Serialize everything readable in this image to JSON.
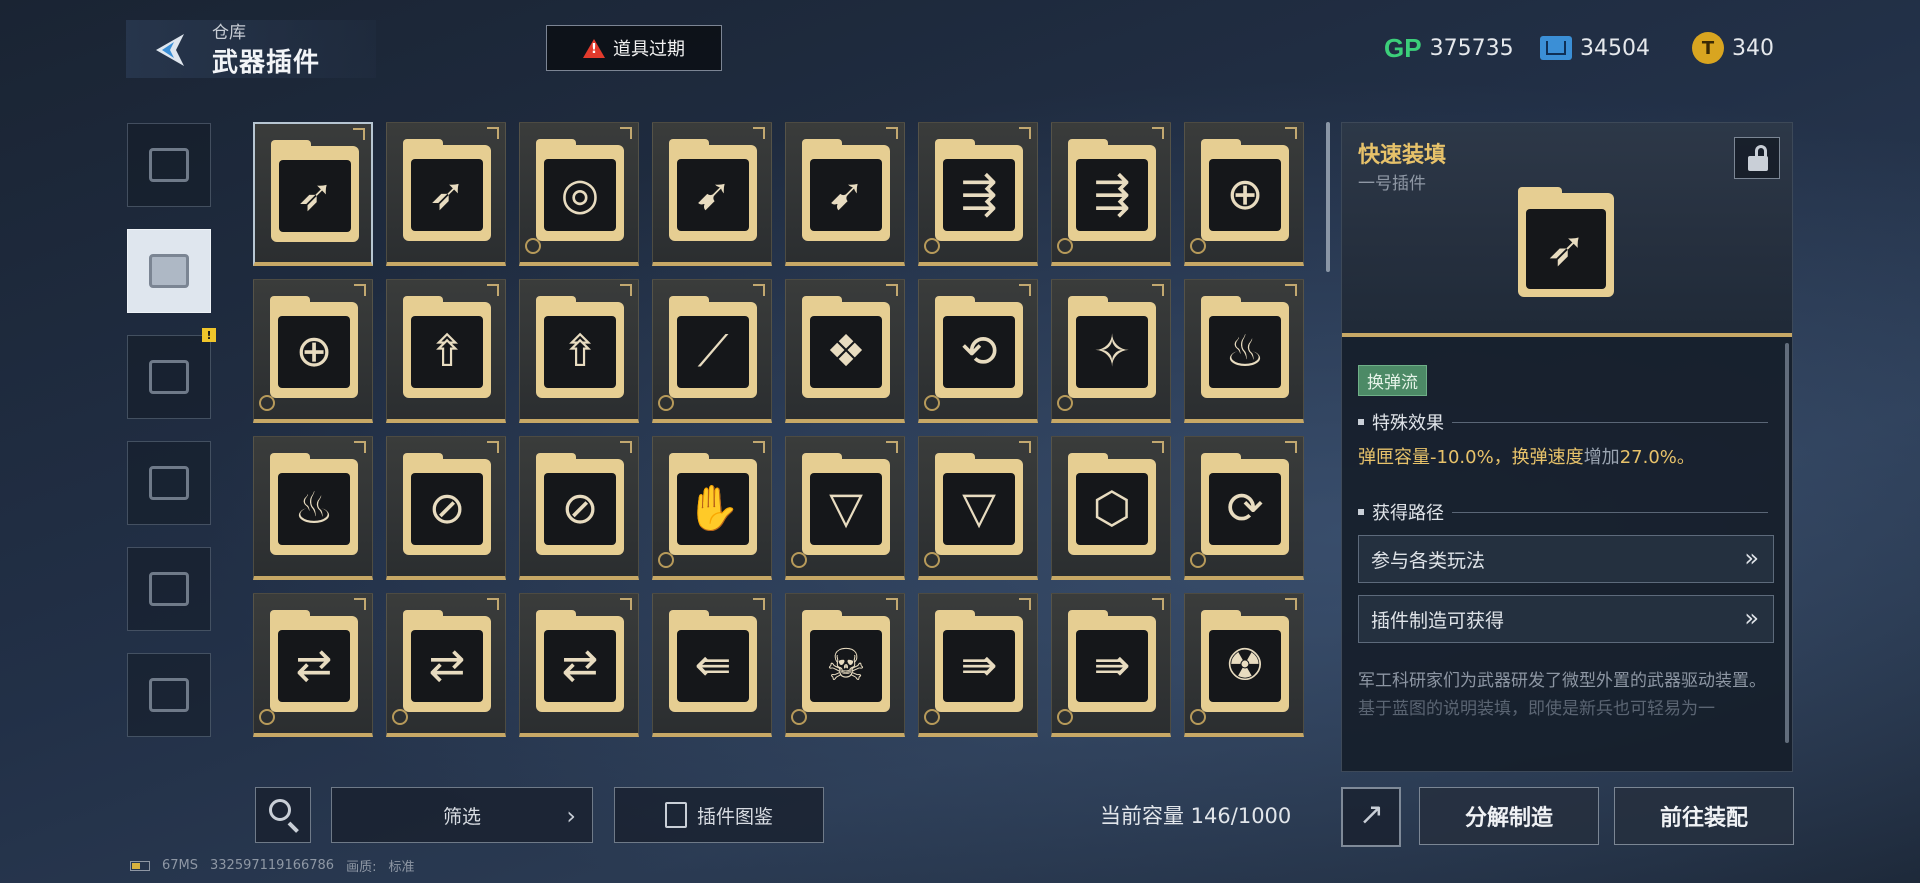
{
  "header": {
    "breadcrumb": "仓库",
    "title": "武器插件",
    "expire_button": "道具过期"
  },
  "currencies": [
    {
      "icon": "gp-icon",
      "label": "GP",
      "value": "375735"
    },
    {
      "icon": "chip-icon",
      "value": "34504"
    },
    {
      "icon": "coin-icon",
      "value": "340"
    }
  ],
  "categories": [
    {
      "name": "pistol-icon"
    },
    {
      "name": "plugin-card-icon",
      "active": true
    },
    {
      "name": "grenade-icon",
      "alert": "!"
    },
    {
      "name": "swap-icon"
    },
    {
      "name": "figure-icon"
    },
    {
      "name": "star-badge-icon"
    }
  ],
  "grid": {
    "slots": [
      {
        "glyph": "➶",
        "gear": false,
        "selected": true
      },
      {
        "glyph": "➶",
        "gear": false
      },
      {
        "glyph": "◎",
        "gear": true
      },
      {
        "glyph": "➹",
        "gear": false
      },
      {
        "glyph": "➹",
        "gear": false
      },
      {
        "glyph": "⇶",
        "gear": true
      },
      {
        "glyph": "⇶",
        "gear": true
      },
      {
        "glyph": "⊕",
        "gear": true
      },
      {
        "glyph": "⊕",
        "gear": true
      },
      {
        "glyph": "⇮",
        "gear": false
      },
      {
        "glyph": "⇮",
        "gear": false
      },
      {
        "glyph": "⟋",
        "gear": true
      },
      {
        "glyph": "❖",
        "gear": false
      },
      {
        "glyph": "⟲",
        "gear": true
      },
      {
        "glyph": "✧",
        "gear": true
      },
      {
        "glyph": "♨",
        "gear": false
      },
      {
        "glyph": "♨",
        "gear": false
      },
      {
        "glyph": "⊘",
        "gear": false
      },
      {
        "glyph": "⊘",
        "gear": false
      },
      {
        "glyph": "✋",
        "gear": true
      },
      {
        "glyph": "▽",
        "gear": true
      },
      {
        "glyph": "▽",
        "gear": true
      },
      {
        "glyph": "⬡",
        "gear": false
      },
      {
        "glyph": "⟳",
        "gear": true
      },
      {
        "glyph": "⇄",
        "gear": true
      },
      {
        "glyph": "⇄",
        "gear": true
      },
      {
        "glyph": "⇄",
        "gear": false
      },
      {
        "glyph": "⇚",
        "gear": false
      },
      {
        "glyph": "☠",
        "gear": true
      },
      {
        "glyph": "⇛",
        "gear": true
      },
      {
        "glyph": "⇛",
        "gear": true
      },
      {
        "glyph": "☢",
        "gear": true
      }
    ]
  },
  "bottom": {
    "filter_label": "筛选",
    "codex_label": "插件图鉴",
    "capacity": "当前容量 146/1000",
    "dismantle_label": "分解制造",
    "equip_label": "前往装配"
  },
  "footer": {
    "ping": "67MS",
    "uid": "332597119166786",
    "quality_label": "画质:",
    "quality_value": "标准"
  },
  "detail": {
    "name": "快速装填",
    "subtitle": "一号插件",
    "glyph": "➶",
    "tag": "换弹流",
    "effect_heading": "特殊效果",
    "effect_part1": "弹匣容量-10.0%，换弹速度",
    "effect_gray": "增加",
    "effect_part2": "27.0%。",
    "source_heading": "获得路径",
    "sources": [
      "参与各类玩法",
      "插件制造可获得"
    ],
    "description": "军工科研家们为武器研发了微型外置的武器驱动装置。",
    "description_faded": "基于蓝图的说明装填，即使是新兵也可轻易为一"
  },
  "colors": {
    "accent_gold": "#e7c26a",
    "slot_frame_gold": "#c7a866",
    "tag_green": "#4c8a66",
    "gp_green": "#3ccf7a",
    "alert_red": "#e23a2c"
  }
}
